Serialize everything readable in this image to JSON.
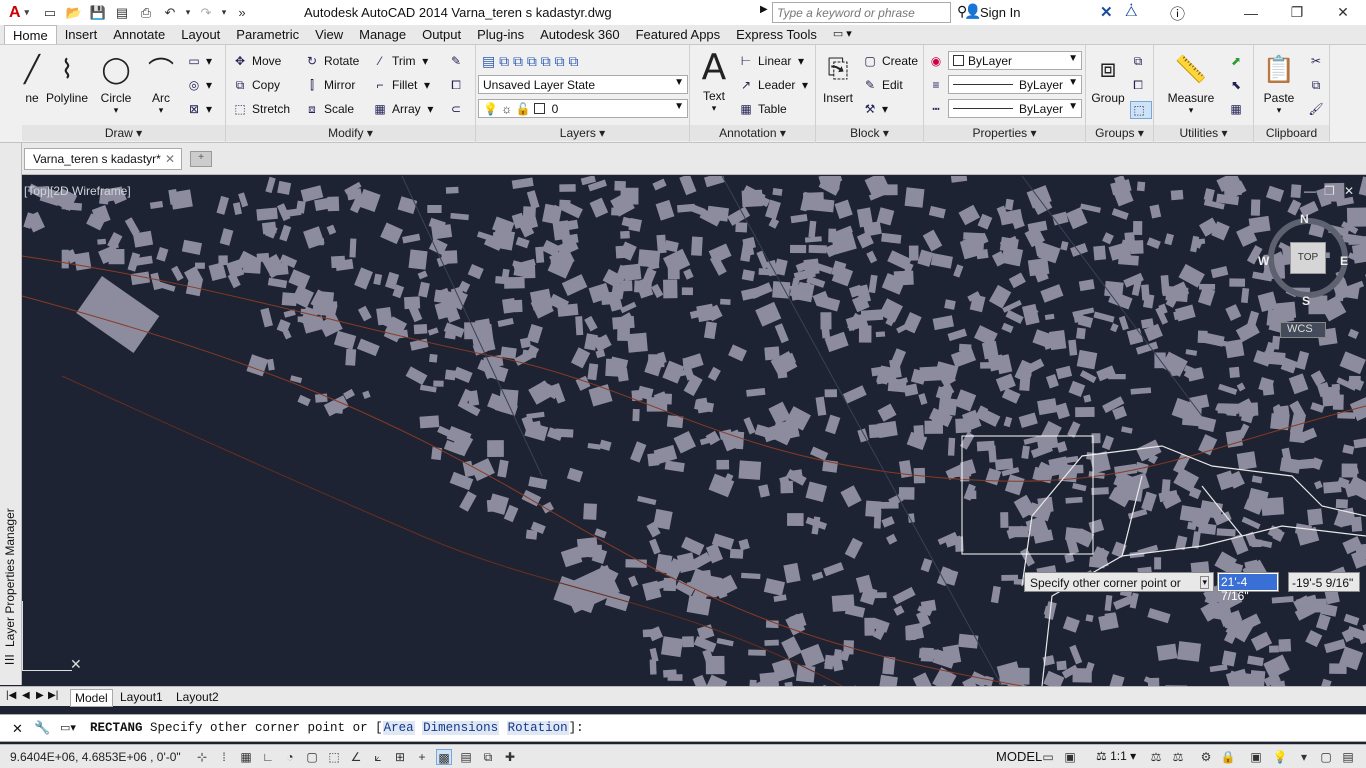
{
  "app": {
    "title": "Autodesk AutoCAD 2014   Varna_teren s kadastyr.dwg",
    "search_placeholder": "Type a keyword or phrase",
    "sign_in": "Sign In"
  },
  "qat": {
    "overflow_icon": "chevron-double-right-icon"
  },
  "ribbon_tabs": [
    "Home",
    "Insert",
    "Annotate",
    "Layout",
    "Parametric",
    "View",
    "Manage",
    "Output",
    "Plug-ins",
    "Autodesk 360",
    "Featured Apps",
    "Express Tools"
  ],
  "draw": {
    "label": "Draw",
    "line": "ne",
    "polyline": "Polyline",
    "circle": "Circle",
    "arc": "Arc"
  },
  "modify": {
    "label": "Modify",
    "move": "Move",
    "copy": "Copy",
    "stretch": "Stretch",
    "rotate": "Rotate",
    "mirror": "Mirror",
    "scale": "Scale",
    "trim": "Trim",
    "fillet": "Fillet",
    "array": "Array"
  },
  "layers": {
    "label": "Layers",
    "layer_state": "Unsaved Layer State",
    "current_layer": "0"
  },
  "annotation": {
    "label": "Annotation",
    "text": "Text",
    "linear": "Linear",
    "leader": "Leader",
    "table": "Table"
  },
  "block": {
    "label": "Block",
    "insert": "Insert",
    "create": "Create",
    "edit": "Edit"
  },
  "properties": {
    "label": "Properties",
    "color": "ByLayer",
    "linetype": "ByLayer",
    "lineweight": "ByLayer"
  },
  "groups": {
    "label": "Groups",
    "group": "Group"
  },
  "utilities": {
    "label": "Utilities",
    "measure": "Measure"
  },
  "clipboard": {
    "label": "Clipboard",
    "paste": "Paste"
  },
  "document": {
    "tab": "Varna_teren s kadastyr*"
  },
  "viewport": {
    "label": "[Top][2D Wireframe]",
    "viewcube": {
      "top": "TOP",
      "n": "N",
      "s": "S",
      "e": "E",
      "w": "W",
      "wcs": "WCS"
    }
  },
  "left_palette": "Layer Properties Manager",
  "layout_tabs": [
    "Model",
    "Layout1",
    "Layout2"
  ],
  "dynamic_input": {
    "prompt": "Specify other corner point or",
    "value1": "21'-4 7/16\"",
    "value2": "-19'-5 9/16\""
  },
  "command": {
    "command": "RECTANG",
    "text": "Specify other corner point or [",
    "opt1": "Area",
    "opt2": "Dimensions",
    "opt3": "Rotation",
    "end": "]:"
  },
  "status": {
    "coords": "9.6404E+06, 4.6853E+06 , 0'-0\"",
    "model": "MODEL",
    "scale": "1:1"
  }
}
